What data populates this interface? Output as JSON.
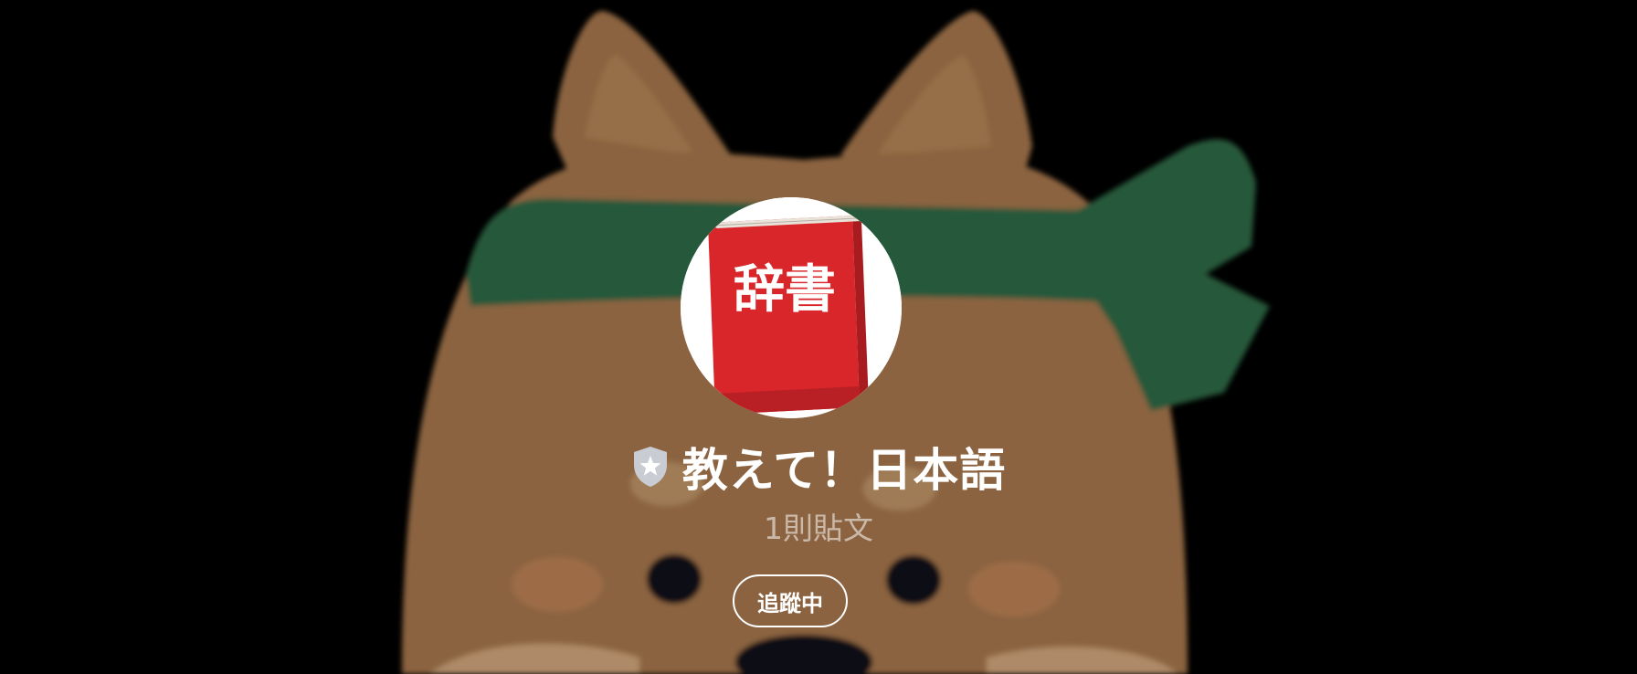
{
  "cover": {
    "image": "shiba-dog-with-green-headband",
    "colors": {
      "background": "#000000",
      "fur": "#8B6440",
      "headband": "#25583A",
      "nose": "#0F0F14"
    }
  },
  "avatar": {
    "image": "red-dictionary-book",
    "book_title": "辞書",
    "colors": {
      "book": "#D8262A",
      "ring": "#FFFFFF"
    }
  },
  "profile": {
    "badge_icon": "shield-star-icon",
    "name": "教えて！日本語",
    "post_count": "1則貼文",
    "follow_label": "追蹤中"
  }
}
